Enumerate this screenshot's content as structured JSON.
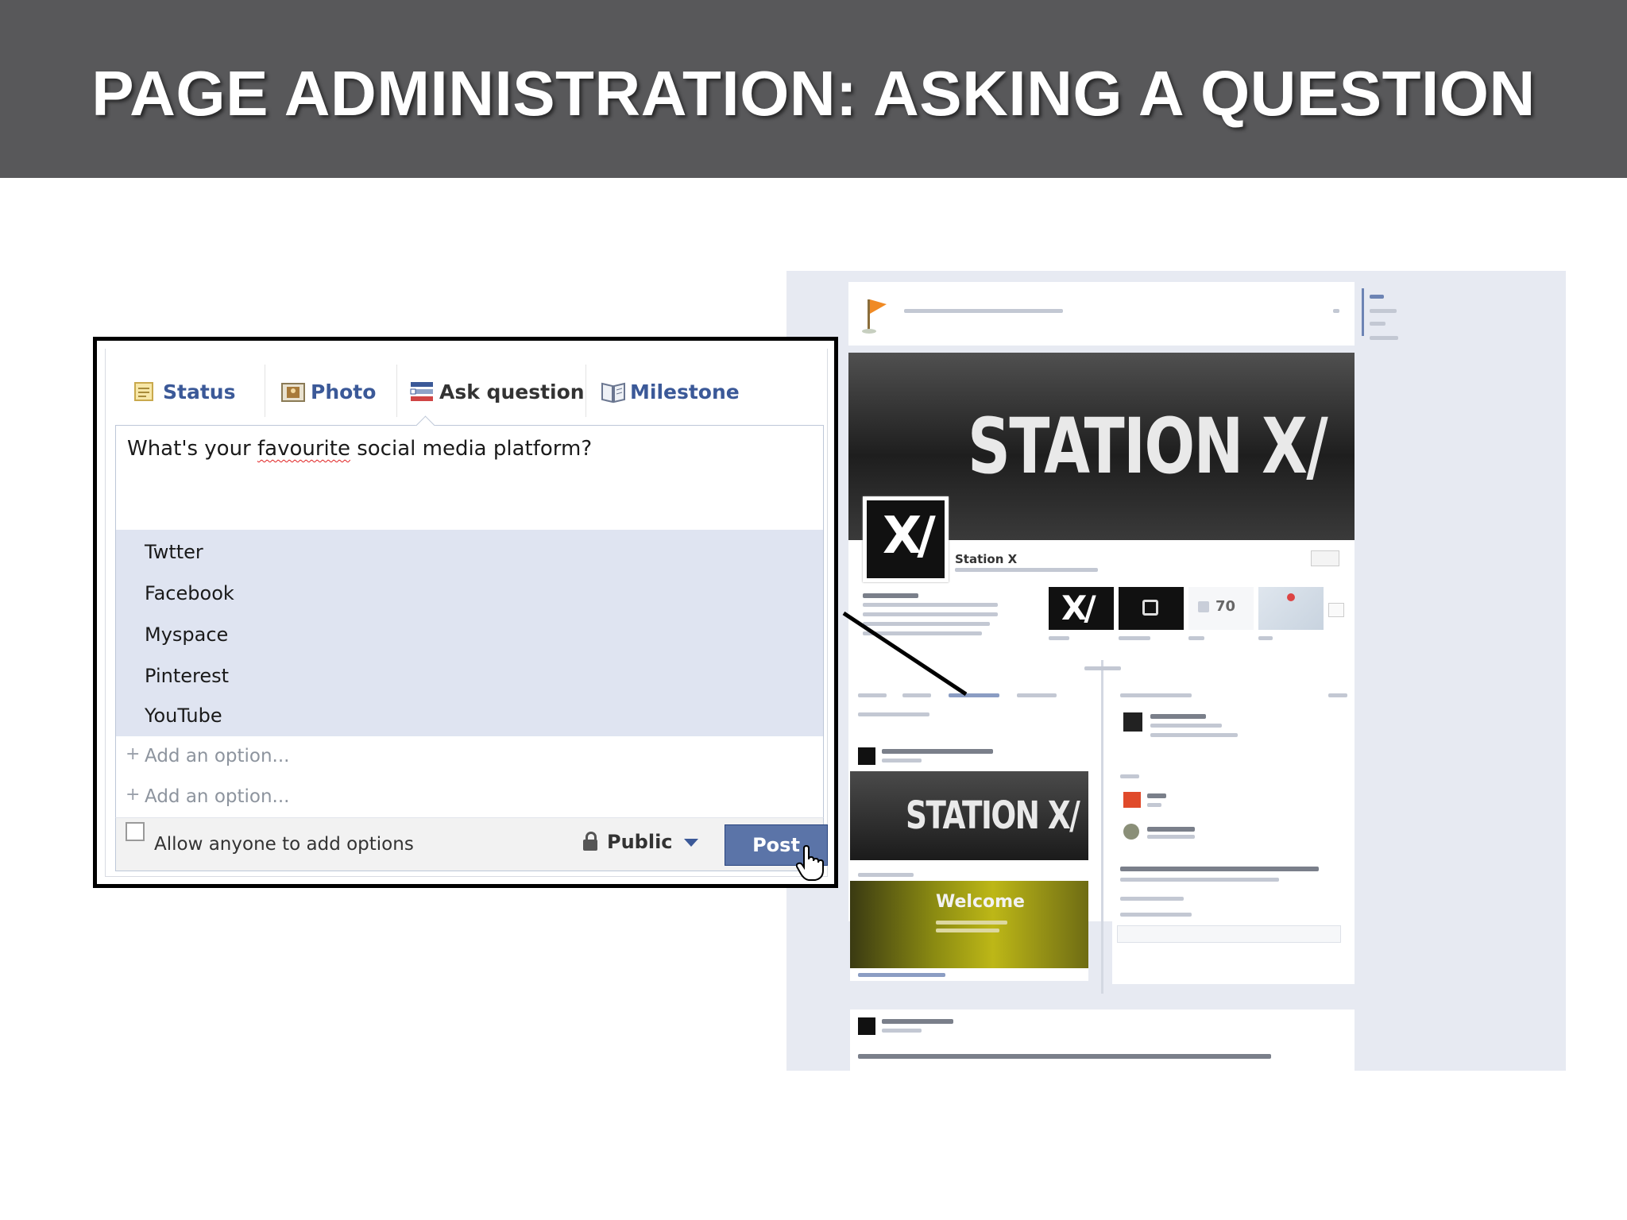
{
  "slide": {
    "title": "PAGE ADMINISTRATION: ASKING A QUESTION"
  },
  "composer": {
    "tabs": [
      {
        "label": "Status",
        "icon": "status-note-icon"
      },
      {
        "label": "Photo",
        "icon": "photo-icon"
      },
      {
        "label": "Ask question",
        "icon": "question-list-icon",
        "active": true
      },
      {
        "label": "Milestone",
        "icon": "milestone-book-icon"
      }
    ],
    "question_parts": [
      "What's your ",
      "favourite",
      " social media platform?"
    ],
    "options": [
      "Twtter",
      "Facebook",
      "Myspace",
      "Pinterest",
      "YouTube"
    ],
    "add_option_placeholder": "Add an option...",
    "allow_label": "Allow anyone to add options",
    "audience": "Public",
    "post_label": "Post"
  },
  "fb_page": {
    "cover_brand": "STATION X/",
    "page_name": "Station X",
    "likes_count": "70",
    "post_brand": "STATION X/",
    "welcome_label": "Welcome"
  },
  "colors": {
    "title_bar": "#58585a",
    "facebook_blue": "#3b5998",
    "post_button": "#5b74a8",
    "options_highlight": "#dfe4f1"
  }
}
